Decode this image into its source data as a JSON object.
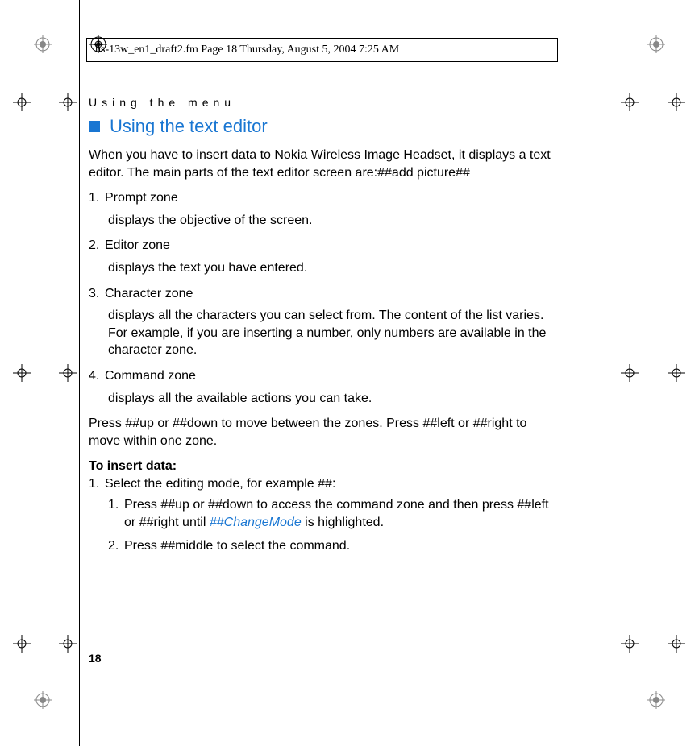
{
  "header": {
    "text": "hs-13w_en1_draft2.fm  Page 18  Thursday, August 5, 2004  7:25 AM"
  },
  "section_header": "Using the menu",
  "title": "Using the text editor",
  "intro": "When you have to insert data to Nokia Wireless Image Headset, it displays a text editor. The main parts of the text editor screen are:##add picture##",
  "zones": [
    {
      "num": "1.",
      "label": "Prompt zone",
      "desc": "displays the objective of the screen."
    },
    {
      "num": "2.",
      "label": "Editor zone",
      "desc": "displays the text you have entered."
    },
    {
      "num": "3.",
      "label": "Character zone",
      "desc": "displays all the characters you can select from. The content of the list varies. For example, if you are inserting a number, only numbers are available in the character zone."
    },
    {
      "num": "4.",
      "label": "Command zone",
      "desc": "displays all the available actions you can take."
    }
  ],
  "nav_text": "Press ##up or ##down to move between the zones. Press ##left or ##right to move within one zone.",
  "insert_heading": "To insert data:",
  "insert_step1": {
    "num": "1.",
    "text": "Select the editing mode, for example ##:"
  },
  "substeps": [
    {
      "num": "1.",
      "text_before": "Press ##up or ##down to access the command zone and then press ##left or ##right until ",
      "link": "##ChangeMode",
      "text_after": " is highlighted."
    },
    {
      "num": "2.",
      "text_before": "Press ##middle to select the command.",
      "link": "",
      "text_after": ""
    }
  ],
  "page_number": "18"
}
